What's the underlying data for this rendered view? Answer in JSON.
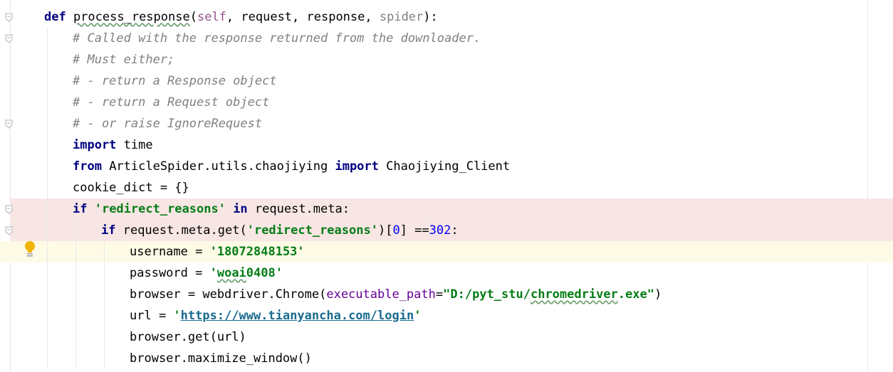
{
  "editor": {
    "lines": [
      {
        "indent": 0,
        "tokens": [
          {
            "t": "kw",
            "v": "def "
          },
          {
            "t": "wv",
            "v": "process_response"
          },
          {
            "t": "p",
            "v": "("
          },
          {
            "t": "slf",
            "v": "self"
          },
          {
            "t": "p",
            "v": ", request, response, "
          },
          {
            "t": "param",
            "v": "spider"
          },
          {
            "t": "p",
            "v": "):"
          }
        ]
      },
      {
        "indent": 1,
        "tokens": [
          {
            "t": "cm",
            "v": "# Called with the response returned from the downloader."
          }
        ]
      },
      {
        "indent": 1,
        "tokens": [
          {
            "t": "cm",
            "v": "# Must either;"
          }
        ]
      },
      {
        "indent": 1,
        "tokens": [
          {
            "t": "cm",
            "v": "# - return a Response object"
          }
        ]
      },
      {
        "indent": 1,
        "tokens": [
          {
            "t": "cm",
            "v": "# - return a Request object"
          }
        ]
      },
      {
        "indent": 1,
        "tokens": [
          {
            "t": "cm",
            "v": "# - or raise IgnoreRequest"
          }
        ]
      },
      {
        "indent": 1,
        "tokens": [
          {
            "t": "kw",
            "v": "import "
          },
          {
            "t": "p",
            "v": "time"
          }
        ]
      },
      {
        "indent": 1,
        "tokens": [
          {
            "t": "kw",
            "v": "from "
          },
          {
            "t": "p",
            "v": "ArticleSpider.utils.chaojiying "
          },
          {
            "t": "kw",
            "v": "import "
          },
          {
            "t": "p",
            "v": "Chaojiying_Client"
          }
        ]
      },
      {
        "indent": 1,
        "tokens": [
          {
            "t": "p",
            "v": "cookie_dict = {}"
          }
        ]
      },
      {
        "indent": 1,
        "hl": "red",
        "tokens": [
          {
            "t": "kw",
            "v": "if "
          },
          {
            "t": "st",
            "v": "'redirect_reasons'"
          },
          {
            "t": "kw",
            "v": " in "
          },
          {
            "t": "p",
            "v": "request.meta:"
          }
        ]
      },
      {
        "indent": 2,
        "hl": "red",
        "tokens": [
          {
            "t": "kw",
            "v": "if "
          },
          {
            "t": "p",
            "v": "request.meta.get("
          },
          {
            "t": "st",
            "v": "'redirect_reasons'"
          },
          {
            "t": "p",
            "v": ")["
          },
          {
            "t": "num",
            "v": "0"
          },
          {
            "t": "p",
            "v": "] =="
          },
          {
            "t": "num",
            "v": "302"
          },
          {
            "t": "p",
            "v": ":"
          }
        ]
      },
      {
        "indent": 3,
        "hl": "yellow",
        "tokens": [
          {
            "t": "p",
            "v": "username = "
          },
          {
            "t": "st",
            "v": "'18072848153'"
          }
        ]
      },
      {
        "indent": 3,
        "tokens": [
          {
            "t": "p",
            "v": "password = "
          },
          {
            "t": "st",
            "v": "'"
          },
          {
            "t": "stw",
            "v": "woai"
          },
          {
            "t": "st",
            "v": "0408'"
          }
        ]
      },
      {
        "indent": 3,
        "tokens": [
          {
            "t": "p",
            "v": "browser = webdriver.Chrome("
          },
          {
            "t": "nm",
            "v": "executable_path"
          },
          {
            "t": "p",
            "v": "="
          },
          {
            "t": "st",
            "v": "\"D:/pyt_stu/"
          },
          {
            "t": "stw",
            "v": "chromedriver"
          },
          {
            "t": "st",
            "v": ".exe\""
          },
          {
            "t": "p",
            "v": ")"
          }
        ]
      },
      {
        "indent": 3,
        "tokens": [
          {
            "t": "p",
            "v": "url = "
          },
          {
            "t": "st",
            "v": "'"
          },
          {
            "t": "lnk",
            "v": "https://www.tianyancha.com/login"
          },
          {
            "t": "st",
            "v": "'"
          }
        ]
      },
      {
        "indent": 3,
        "tokens": [
          {
            "t": "p",
            "v": "browser.get(url)"
          }
        ]
      },
      {
        "indent": 3,
        "tokens": [
          {
            "t": "p",
            "v": "browser.maximize_window()"
          }
        ]
      }
    ]
  },
  "gutter": {
    "fold_markers": [
      0,
      1,
      5,
      9,
      10
    ],
    "intention_icon": "lightbulb-icon"
  },
  "colors": {
    "keyword": "#000080",
    "comment": "#808080",
    "string": "#067d17",
    "number": "#0000ff",
    "self": "#94558d",
    "named_arg": "#660099",
    "error_line_bg": "#f7e6e4",
    "current_line_bg": "#fdfbe6"
  }
}
